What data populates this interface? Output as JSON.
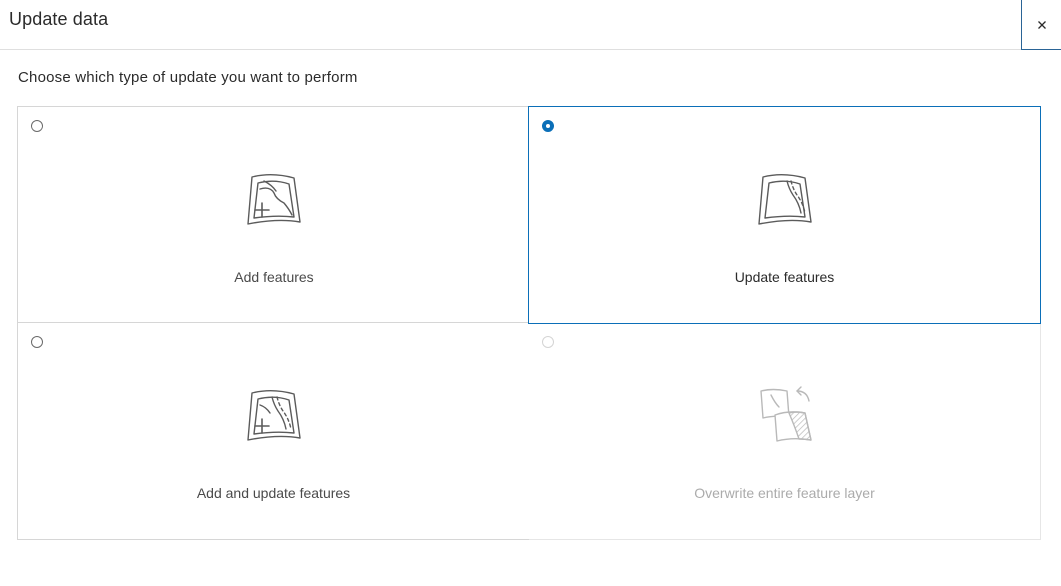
{
  "dialog": {
    "title": "Update data",
    "close_icon": "close-icon"
  },
  "prompt": "Choose which type of update you want to perform",
  "options": [
    {
      "label": "Add features",
      "selected": false,
      "disabled": false,
      "icon": "map-add-icon"
    },
    {
      "label": "Update features",
      "selected": true,
      "disabled": false,
      "icon": "map-update-icon"
    },
    {
      "label": "Add and update features",
      "selected": false,
      "disabled": false,
      "icon": "map-add-update-icon"
    },
    {
      "label": "Overwrite entire feature layer",
      "selected": false,
      "disabled": true,
      "icon": "layer-overwrite-icon"
    }
  ],
  "colors": {
    "accent": "#0b6fb8",
    "border": "#d6d6d6",
    "disabled_text": "#ababab"
  }
}
